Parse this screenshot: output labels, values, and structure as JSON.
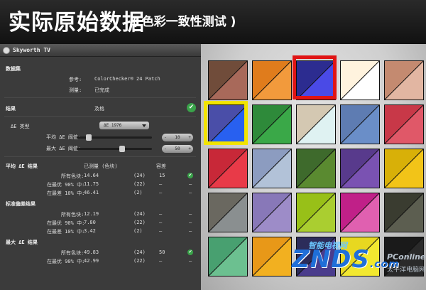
{
  "banner": {
    "title": "实际原始数据",
    "subtitle": "( 色彩一致性测试 )"
  },
  "window": {
    "title": "Skyworth TV"
  },
  "dataset": {
    "heading": "数据集",
    "ref_label": "参考:",
    "ref_value": "ColorChecker® 24 Patch",
    "measure_label": "测量:",
    "measure_value": "已完成"
  },
  "result": {
    "heading": "结果",
    "value": "及格",
    "ok_glyph": "✔"
  },
  "delta": {
    "type_label": "ΔE 类型",
    "type_value": "ΔE 1976",
    "avg_thresh_label": "平均 ΔE 阈值:",
    "avg_thresh_value": "10",
    "max_thresh_label": "最大 ΔE 阈值:",
    "max_thresh_value": "50",
    "spin_minus": "-",
    "spin_plus": "+"
  },
  "avg_section": {
    "heading": "平均 ΔE 结果",
    "col_measured": "已测量 (色块)",
    "col_tol": "容差",
    "rows": [
      {
        "label": "所有色块:",
        "value": "14.64",
        "count": "(24)",
        "tol": "15",
        "check": true
      },
      {
        "label": "在最优 90% 中:",
        "value": "11.75",
        "count": "(22)",
        "tol": "–",
        "check": false
      },
      {
        "label": "在最差 10% 中:",
        "value": "46.41",
        "count": "(2)",
        "tol": "–",
        "check": false
      }
    ]
  },
  "std_section": {
    "heading": "标准偏差结果",
    "rows": [
      {
        "label": "所有色块:",
        "value": "12.19",
        "count": "(24)",
        "tol": "–",
        "check": false
      },
      {
        "label": "在最优 90% 中:",
        "value": "7.80",
        "count": "(22)",
        "tol": "–",
        "check": false
      },
      {
        "label": "在最差 10% 中:",
        "value": "3.42",
        "count": "(2)",
        "tol": "–",
        "check": false
      }
    ]
  },
  "max_section": {
    "heading": "最大 ΔE 结果",
    "rows": [
      {
        "label": "所有色块:",
        "value": "49.83",
        "count": "(24)",
        "tol": "50",
        "check": true
      },
      {
        "label": "在最优 90% 中:",
        "value": "42.99",
        "count": "(22)",
        "tol": "–",
        "check": false
      }
    ]
  },
  "dash": "–",
  "patches": [
    [
      "#704c3a",
      "#a8695a"
    ],
    [
      "#e07c1c",
      "#f29a3c"
    ],
    [
      "#2c2c90",
      "#4a4ae6"
    ],
    [
      "#fff3de",
      "#ffffff"
    ],
    [
      "#c48a70",
      "#e2b6a2"
    ],
    [
      "#4a4ea8",
      "#2860f0"
    ],
    [
      "#2e8a3a",
      "#3aa848"
    ],
    [
      "#d4c8b2",
      "#dff2f2"
    ],
    [
      "#5e7cb2",
      "#6a8ec8"
    ],
    [
      "#c83848",
      "#e05868"
    ],
    [
      "#c82838",
      "#e83a48"
    ],
    [
      "#8c9cc0",
      "#b2c2d8"
    ],
    [
      "#3e6a2c",
      "#5a8a30"
    ],
    [
      "#583a8c",
      "#7a52b2"
    ],
    [
      "#d8b008",
      "#f2c418"
    ],
    [
      "#6a6860",
      "#8a8f90"
    ],
    [
      "#8878b8",
      "#9d8cc8"
    ],
    [
      "#98c018",
      "#aace30"
    ],
    [
      "#c02088",
      "#e060b0"
    ],
    [
      "#3a3c30",
      "#5c5e50"
    ],
    [
      "#48a070",
      "#6cc090"
    ],
    [
      "#e89818",
      "#f2b020"
    ],
    [
      "#2c2c5a",
      "#4a3c8c"
    ],
    [
      "#e8d820",
      "#f2e830"
    ],
    [
      "#1a1a1a",
      "#2a2a2a"
    ]
  ],
  "watermark": {
    "zh": "智能电视网",
    "znds": "ZNDS",
    "com": ".com",
    "pconline": "PConline",
    "pc_zh": "太平洋电脑网"
  }
}
